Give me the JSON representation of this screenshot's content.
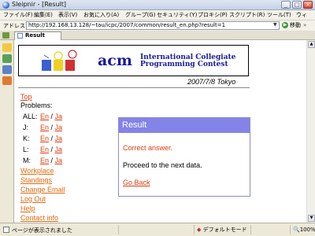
{
  "window": {
    "title": "Sleipnir - [Result]"
  },
  "menubar": {
    "items": [
      "ファイル(F)",
      "編集(E)",
      "表示(V)",
      "お気に入り(A)",
      "グループ(G)",
      "セキュリティ(Y)",
      "プロキシ(P)",
      "スクリプト(R)",
      "ツール(T)",
      "ウィ"
    ]
  },
  "address": {
    "label": "アドレス",
    "url": "http://192.168.13.128/~tau/icpc/2007/common/result_en.php?result=1",
    "go_label": "移動"
  },
  "tab": {
    "label": "Result"
  },
  "banner": {
    "acm": "acm",
    "line1": "International Collegiate",
    "line2": "Programming Contest",
    "date": "2007/7/8 Tokyo"
  },
  "nav": {
    "top": "Top",
    "problems_label": "Problems:",
    "problems": [
      {
        "label": "ALL:",
        "en": "En",
        "sep": " / ",
        "ja": "Ja"
      },
      {
        "label": "J:",
        "en": "En",
        "sep": " / ",
        "ja": "Ja"
      },
      {
        "label": "K:",
        "en": "En",
        "sep": " / ",
        "ja": "Ja"
      },
      {
        "label": "L:",
        "en": "En",
        "sep": " / ",
        "ja": "Ja"
      },
      {
        "label": "M:",
        "en": "En",
        "sep": " / ",
        "ja": "Ja"
      }
    ],
    "workplace": "Workplace",
    "standings": "Standings",
    "change_email": "Change Email",
    "logout": "Log Out",
    "help": "Help",
    "contact": "Contact info"
  },
  "dialog": {
    "title": "Result",
    "message": "Correct answer.",
    "next": "Proceed to the next data.",
    "back": "Go Back"
  },
  "status": {
    "text": "ページが表示されました",
    "mode": "デフォルトモード",
    "zoom": "100%"
  },
  "colors": {
    "link": "#e03c12",
    "nav_link": "#e06a10",
    "dialog_header": "#8484e8",
    "acm_blue": "#1a1aa0"
  }
}
